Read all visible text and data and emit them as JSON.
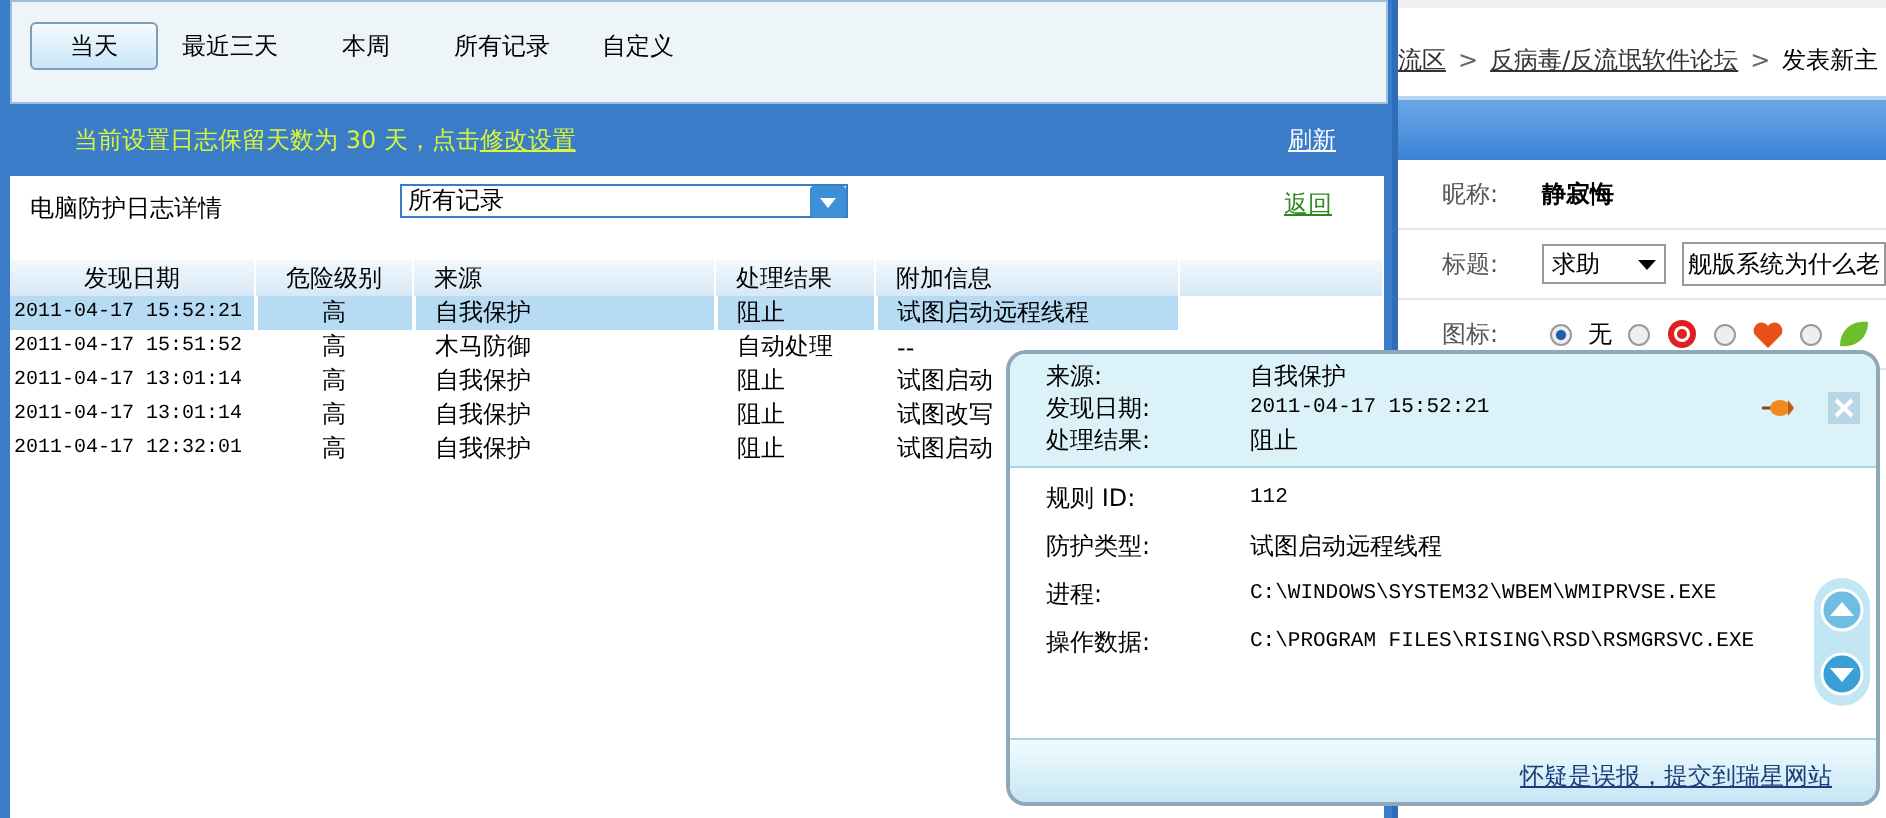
{
  "tabs": [
    {
      "label": "当天",
      "selected": true
    },
    {
      "label": "最近三天",
      "selected": false
    },
    {
      "label": "本周",
      "selected": false
    },
    {
      "label": "所有记录",
      "selected": false
    },
    {
      "label": "自定义",
      "selected": false
    }
  ],
  "notice": {
    "text": "当前设置日志保留天数为 30 天，点击",
    "link": "修改设置",
    "refresh": "刷新"
  },
  "log": {
    "title": "电脑防护日志详情",
    "filter": "所有记录",
    "back": "返回",
    "columns": [
      "发现日期",
      "危险级别",
      "来源",
      "处理结果",
      "附加信息"
    ],
    "rows": [
      {
        "cells": [
          "2011-04-17 15:52:21",
          "高",
          "自我保护",
          "阻止",
          "试图启动远程线程"
        ],
        "selected": true
      },
      {
        "cells": [
          "2011-04-17 15:51:52",
          "高",
          "木马防御",
          "自动处理",
          "--"
        ],
        "selected": false
      },
      {
        "cells": [
          "2011-04-17 13:01:14",
          "高",
          "自我保护",
          "阻止",
          "试图启动"
        ],
        "selected": false
      },
      {
        "cells": [
          "2011-04-17 13:01:14",
          "高",
          "自我保护",
          "阻止",
          "试图改写"
        ],
        "selected": false
      },
      {
        "cells": [
          "2011-04-17 12:32:01",
          "高",
          "自我保护",
          "阻止",
          "试图启动"
        ],
        "selected": false
      }
    ]
  },
  "popup": {
    "summary": [
      {
        "label": "来源:",
        "value": "自我保护"
      },
      {
        "label": "发现日期:",
        "value": "2011-04-17 15:52:21"
      },
      {
        "label": "处理结果:",
        "value": "阻止"
      }
    ],
    "details": [
      {
        "label": "规则 ID:",
        "value": "112"
      },
      {
        "label": "防护类型:",
        "value": "试图启动远程线程"
      },
      {
        "label": "进程:",
        "value": "C:\\WINDOWS\\SYSTEM32\\WBEM\\WMIPRVSE.EXE"
      },
      {
        "label": "操作数据:",
        "value": "C:\\PROGRAM FILES\\RISING\\RSD\\RSMGRSVC.EXE"
      }
    ],
    "report_link": "怀疑是误报，提交到瑞星网站"
  },
  "forum": {
    "breadcrumb": [
      "流区",
      "反病毒/反流氓软件论坛",
      "发表新主"
    ],
    "separator": ">",
    "nickname": {
      "label": "昵称:",
      "value": "静寂悔"
    },
    "subject": {
      "label": "标题:",
      "category": "求助",
      "value": "舰版系统为什么老"
    },
    "icon_row": {
      "label": "图标:",
      "options": [
        {
          "kind": "none",
          "label": "无",
          "selected": true
        },
        {
          "kind": "lifebuoy",
          "selected": false
        },
        {
          "kind": "heart",
          "selected": false
        },
        {
          "kind": "leaf",
          "selected": false
        }
      ]
    }
  }
}
